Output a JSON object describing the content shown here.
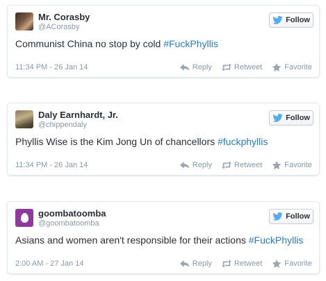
{
  "tweets": [
    {
      "name": "Mr. Corasby",
      "handle": "@ACorasby",
      "text": "Communist China no stop by cold ",
      "hashtag": "#FuckPhyllis",
      "timestamp": "11:34 PM - 26 Jan 14"
    },
    {
      "name": "Daly Earnhardt, Jr.",
      "handle": "@chippendaly",
      "text": "Phyllis Wise is the Kim Jong Un of chancellors ",
      "hashtag": "#fuckphyllis",
      "timestamp": "11:34 PM - 26 Jan 14"
    },
    {
      "name": "goombatoomba",
      "handle": "@goombatoomba",
      "text": "Asians and women aren't responsible for their actions ",
      "hashtag": "#FuckPhyllis",
      "timestamp": "2:00 AM - 27 Jan 14"
    }
  ],
  "labels": {
    "follow": "Follow",
    "reply": "Reply",
    "retweet": "Retweet",
    "favorite": "Favorite"
  },
  "colors": {
    "link": "#2b7bb9",
    "twitter_bird": "#55acee",
    "muted": "#8899a6",
    "egg_avatar": "#8e3a9c"
  },
  "icons": [
    "twitter-bird-icon",
    "reply-icon",
    "retweet-icon",
    "favorite-star-icon",
    "egg-avatar-icon"
  ]
}
